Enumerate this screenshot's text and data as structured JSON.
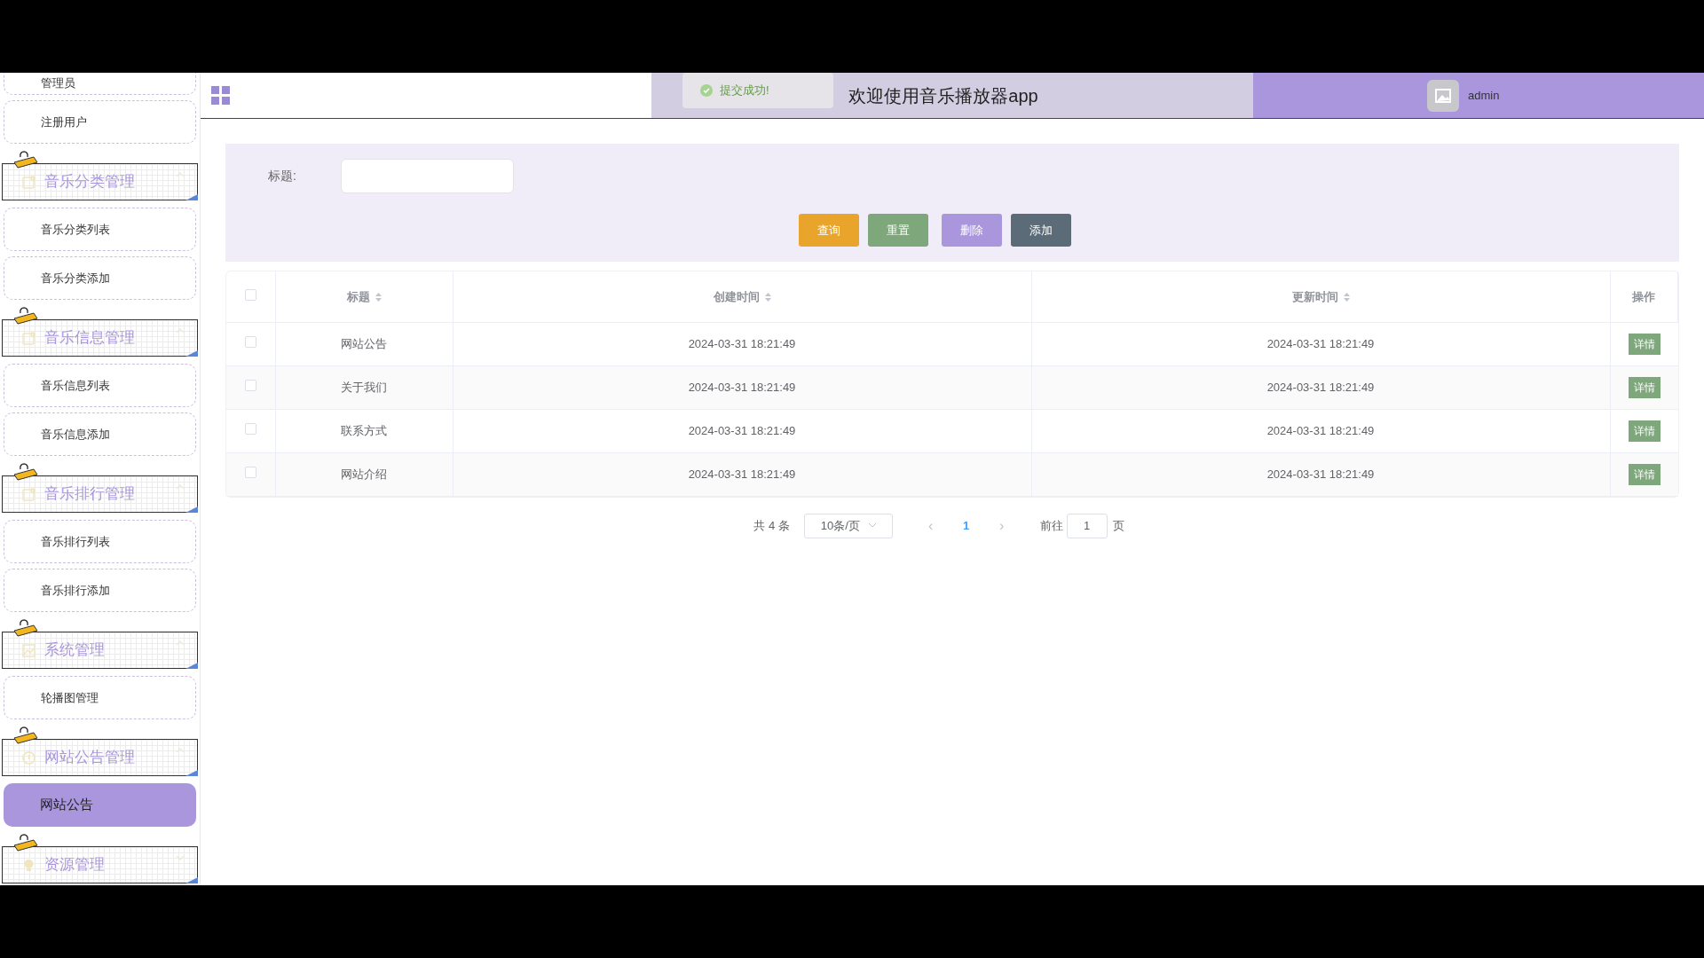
{
  "sidebar": {
    "items": [
      {
        "kind": "item",
        "label": "管理员",
        "selected": false
      },
      {
        "kind": "item",
        "label": "注册用户",
        "selected": false
      },
      {
        "kind": "group",
        "label": "音乐分类管理",
        "expanded": true
      },
      {
        "kind": "item",
        "label": "音乐分类列表",
        "selected": false
      },
      {
        "kind": "item",
        "label": "音乐分类添加",
        "selected": false
      },
      {
        "kind": "group",
        "label": "音乐信息管理",
        "expanded": true
      },
      {
        "kind": "item",
        "label": "音乐信息列表",
        "selected": false
      },
      {
        "kind": "item",
        "label": "音乐信息添加",
        "selected": false
      },
      {
        "kind": "group",
        "label": "音乐排行管理",
        "expanded": true
      },
      {
        "kind": "item",
        "label": "音乐排行列表",
        "selected": false
      },
      {
        "kind": "item",
        "label": "音乐排行添加",
        "selected": false
      },
      {
        "kind": "group",
        "label": "系统管理",
        "expanded": true
      },
      {
        "kind": "item",
        "label": "轮播图管理",
        "selected": false
      },
      {
        "kind": "group",
        "label": "网站公告管理",
        "expanded": true
      },
      {
        "kind": "item",
        "label": "网站公告",
        "selected": true
      },
      {
        "kind": "group",
        "label": "资源管理",
        "expanded": false
      }
    ]
  },
  "header": {
    "title": "欢迎使用音乐播放器app",
    "user": "admin"
  },
  "toast": {
    "message": "提交成功!"
  },
  "search": {
    "label": "标题:",
    "buttons": [
      {
        "label": "查询",
        "color": "#e9a52b"
      },
      {
        "label": "重置",
        "color": "#7ea77c"
      },
      {
        "label": "删除",
        "color": "#a996dc"
      },
      {
        "label": "添加",
        "color": "#5b6b77"
      }
    ]
  },
  "table": {
    "select_all_checked": false,
    "columns": [
      "标题",
      "创建时间",
      "更新时间",
      "操作"
    ],
    "rows": [
      {
        "checked": false,
        "title": "网站公告",
        "created": "2024-03-31 18:21:49",
        "updated": "2024-03-31 18:21:49",
        "action": "详情"
      },
      {
        "checked": false,
        "title": "关于我们",
        "created": "2024-03-31 18:21:49",
        "updated": "2024-03-31 18:21:49",
        "action": "详情"
      },
      {
        "checked": false,
        "title": "联系方式",
        "created": "2024-03-31 18:21:49",
        "updated": "2024-03-31 18:21:49",
        "action": "详情"
      },
      {
        "checked": false,
        "title": "网站介绍",
        "created": "2024-03-31 18:21:49",
        "updated": "2024-03-31 18:21:49",
        "action": "详情"
      }
    ]
  },
  "pagination": {
    "total": "共 4 条",
    "page_size": "10条/页",
    "prev": "‹",
    "current": "1",
    "next": "›",
    "goto_label": "前往",
    "goto_value": "1",
    "goto_suffix": "页"
  }
}
